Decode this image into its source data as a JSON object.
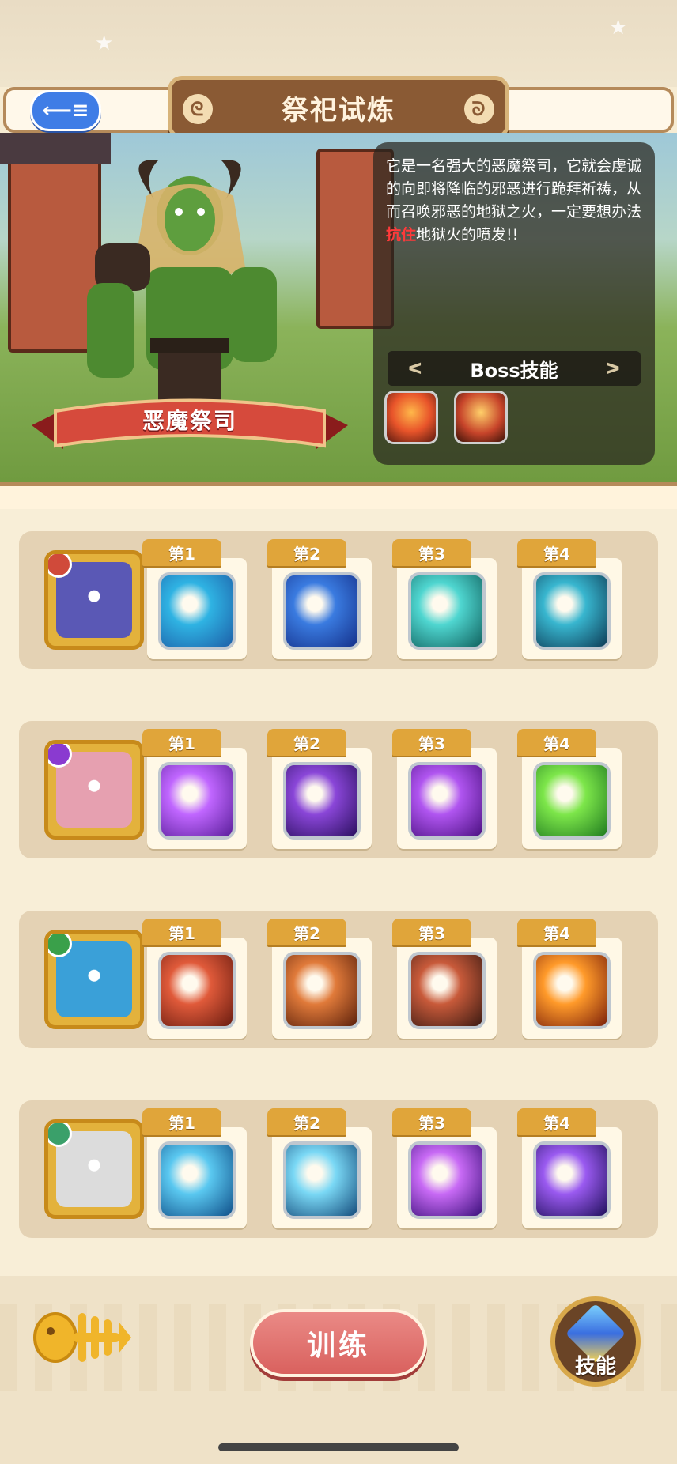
{
  "header": {
    "back_label": "⟵≡",
    "title": "祭祀试炼"
  },
  "boss": {
    "name": "恶魔祭司",
    "description_before": "它是一名强大的恶魔祭司，它就会虔诚的向即将降临的邪恶进行跪拜祈祷，从而召唤邪恶的地狱之火，一定要想办法",
    "description_highlight": "抗住",
    "description_after": "地狱火的喷发!!",
    "skills_title": "Boss技能",
    "skills": [
      {
        "icon": "fire-silhouette-icon",
        "color": "#e8542a"
      },
      {
        "icon": "fire-summon-icon",
        "color": "#c7442a"
      }
    ]
  },
  "rows": [
    {
      "hero": {
        "icon": "knight-penguin-avatar",
        "color": "#5a58b5",
        "badge": "#d04a3a"
      },
      "slots": [
        {
          "label": "第1",
          "icon": "water-splash-icon",
          "c1": "#2fb3e3",
          "c2": "#1d5fa8"
        },
        {
          "label": "第2",
          "icon": "water-flask-icon",
          "c1": "#3a7be0",
          "c2": "#14308a"
        },
        {
          "label": "第3",
          "icon": "shadow-cat-icon",
          "c1": "#4fd6d0",
          "c2": "#10615e"
        },
        {
          "label": "第4",
          "icon": "hammer-icon",
          "c1": "#38b6cf",
          "c2": "#0d3b55"
        }
      ]
    },
    {
      "hero": {
        "icon": "crowned-creature-avatar",
        "color": "#e6a0b0",
        "badge": "#8a3ad0"
      },
      "slots": [
        {
          "label": "第1",
          "icon": "winged-shield-icon",
          "c1": "#c066ff",
          "c2": "#5a1f9a"
        },
        {
          "label": "第2",
          "icon": "dark-sprout-icon",
          "c1": "#8a46d8",
          "c2": "#2a0f5e"
        },
        {
          "label": "第3",
          "icon": "purple-wave-icon",
          "c1": "#b055f0",
          "c2": "#4a1080"
        },
        {
          "label": "第4",
          "icon": "healing-cloud-icon",
          "c1": "#7de64a",
          "c2": "#1f7a1f"
        }
      ]
    },
    {
      "hero": {
        "icon": "blue-fish-avatar",
        "color": "#3aa0d8",
        "badge": "#3aa04a"
      },
      "slots": [
        {
          "label": "第1",
          "icon": "morning-star-icon",
          "c1": "#e05a3a",
          "c2": "#6a1c10"
        },
        {
          "label": "第2",
          "icon": "feather-burst-icon",
          "c1": "#e07a3a",
          "c2": "#5a1f0a"
        },
        {
          "label": "第3",
          "icon": "crossbow-icon",
          "c1": "#c85a3a",
          "c2": "#3a1a12"
        },
        {
          "label": "第4",
          "icon": "campfire-icon",
          "c1": "#ff9a2a",
          "c2": "#7a1f0a"
        }
      ]
    },
    {
      "hero": {
        "icon": "bandaged-bird-avatar",
        "color": "#dcdcdc",
        "badge": "#3aa06a"
      },
      "slots": [
        {
          "label": "第1",
          "icon": "ice-shards-icon",
          "c1": "#5ac8f0",
          "c2": "#10508a"
        },
        {
          "label": "第2",
          "icon": "ice-crystal-icon",
          "c1": "#7ad8f5",
          "c2": "#134a7a"
        },
        {
          "label": "第3",
          "icon": "arcane-bolts-icon",
          "c1": "#c86af5",
          "c2": "#3a0f7a"
        },
        {
          "label": "第4",
          "icon": "crystal-gem-icon",
          "c1": "#9a5af0",
          "c2": "#1f0f5a"
        }
      ]
    }
  ],
  "footer": {
    "train_label": "训练",
    "skill_label": "技能"
  }
}
